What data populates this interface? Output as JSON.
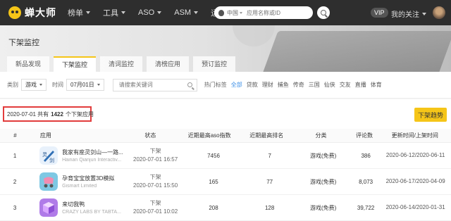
{
  "nav": {
    "brand": "蝉大师",
    "items": [
      {
        "label": "榜单",
        "caret": true
      },
      {
        "label": "工具",
        "caret": true
      },
      {
        "label": "ASO",
        "caret": true
      },
      {
        "label": "ASM",
        "caret": true
      },
      {
        "label": "运营圈",
        "caret": false
      }
    ],
    "country": "中国",
    "search_placeholder": "应用名称或ID",
    "vip": "VIP",
    "follow": "我的关注"
  },
  "hero": {
    "title": "下架监控",
    "tabs": [
      "新品发现",
      "下架监控",
      "清词监控",
      "清榜应用",
      "预订监控"
    ],
    "active_tab": 1
  },
  "filters": {
    "category_label": "类别",
    "category_value": "游戏",
    "time_label": "时间",
    "time_value": "07月01日",
    "keyword_placeholder": "请搜索关键词",
    "tag_label": "热门标签",
    "tags": [
      "全部",
      "贷款",
      "理财",
      "捕鱼",
      "传奇",
      "三国",
      "仙侠",
      "交友",
      "直播",
      "体育"
    ],
    "active_tag": 0
  },
  "summary": {
    "date": "2020-07-01",
    "prefix": "共有",
    "count": "1422",
    "suffix": "个下架应用",
    "trend_button": "下架趋势"
  },
  "table": {
    "headers": [
      "#",
      "应用",
      "状态",
      "近期最高aso指数",
      "近期最高排名",
      "分类",
      "评论数",
      "更新时间/上架时间"
    ],
    "rows": [
      {
        "num": "1",
        "name": "我家有座灵剑山—一路...",
        "dev": "Hainan Qianjun Interactiv...",
        "status": "下架",
        "status_time": "2020-07-01 16:57",
        "aso": "7456",
        "rank": "7",
        "category": "游戏(免费)",
        "reviews": "386",
        "update": "2020-06-12/2020-06-11",
        "icon": "sword"
      },
      {
        "num": "2",
        "name": "孕育宝宝放置3D模拟",
        "dev": "Gismart Limited",
        "status": "下架",
        "status_time": "2020-07-01 15:50",
        "aso": "165",
        "rank": "77",
        "category": "游戏(免费)",
        "reviews": "8,073",
        "update": "2020-06-17/2020-04-09",
        "icon": "stroller"
      },
      {
        "num": "3",
        "name": "来切我鸭",
        "dev": "CRAZY LABS BY TABTA...",
        "status": "下架",
        "status_time": "2020-07-01 10:02",
        "aso": "208",
        "rank": "128",
        "category": "游戏(免费)",
        "reviews": "39,722",
        "update": "2020-06-14/2020-01-31",
        "icon": "cube"
      }
    ]
  },
  "colors": {
    "accent": "#f5c518",
    "highlight_border": "#e23c3c",
    "active_tag": "#3a8ee6"
  }
}
